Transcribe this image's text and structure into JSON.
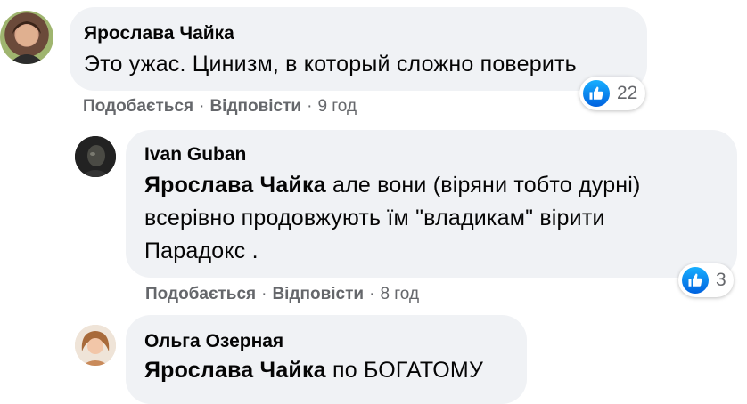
{
  "comments": [
    {
      "author": "Ярослава Чайка",
      "text": "Это ужас. Цинизм, в который сложно поверить",
      "like_label": "Подобається",
      "reply_label": "Відповісти",
      "time": "9 год",
      "reactions": "22"
    },
    {
      "author": "Ivan Guban",
      "mention": "Ярослава Чайка",
      "line1": " але вони (віряни тобто дурні)",
      "line2": "всерівно продовжують їм \"владикам\" вірити",
      "line3": "Парадокс .",
      "like_label": "Подобається",
      "reply_label": "Відповісти",
      "time": "8 год",
      "reactions": "3"
    },
    {
      "author": "Ольга Озерная",
      "mention": "Ярослава Чайка",
      "text": " по БОГАТОМУ"
    }
  ],
  "separator": "·",
  "colors": {
    "bubble": "#f0f2f5",
    "meta": "#65676b",
    "like": "#1877f2"
  },
  "icons": {
    "like": "thumbs-up-icon"
  }
}
